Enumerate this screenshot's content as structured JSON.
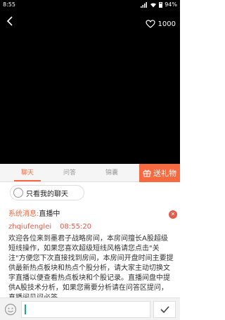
{
  "status": {
    "time": "8:55",
    "battery": "94%"
  },
  "player": {
    "like_count": "1000"
  },
  "tabs": [
    {
      "label": "聊天",
      "active": true
    },
    {
      "label": "问答",
      "active": false
    },
    {
      "label": "锦囊",
      "active": false
    }
  ],
  "gift": {
    "label": "送礼物"
  },
  "filter": {
    "label": "只看我的聊天"
  },
  "chat": {
    "system_prefix": "系统消息:",
    "system_text": "直播中",
    "message": {
      "user": "zhqiufenglei",
      "time": "08:55:20",
      "text": "欢迎各位来到墨君子战略房间，本房间擅长A股超级短线操作，如果您喜欢超级短线风格请您点击\"关注\"方便您下次直接找到房间，本房间开盘时间主要提供最新热点板块和热点个股分析，请大家主动切换文字直播以便查看热点板块和个股记录。直播间盘中提供A股技术分析，如果您需要分析请在问答区提问，直播间见问必答"
    }
  },
  "input": {
    "value": "",
    "placeholder": ""
  },
  "colors": {
    "accent": "#f7693f",
    "user": "#e45a4c"
  }
}
